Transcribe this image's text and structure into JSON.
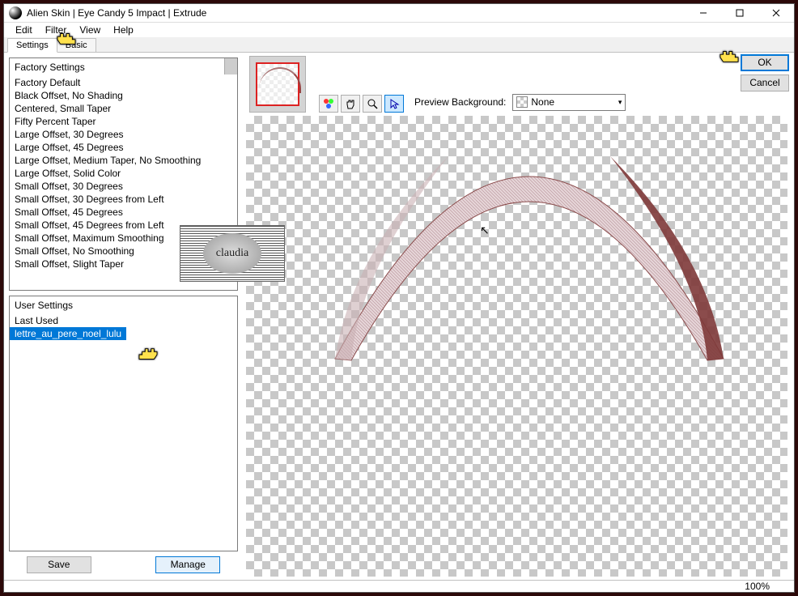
{
  "window_title": "Alien Skin | Eye Candy 5 Impact | Extrude",
  "menu": {
    "edit": "Edit",
    "filter": "Filter",
    "view": "View",
    "help": "Help"
  },
  "tabs": {
    "settings": "Settings",
    "basic": "Basic"
  },
  "factory": {
    "header": "Factory Settings",
    "items": [
      "Factory Default",
      "Black Offset, No Shading",
      "Centered, Small Taper",
      "Fifty Percent Taper",
      "Large Offset, 30 Degrees",
      "Large Offset, 45 Degrees",
      "Large Offset, Medium Taper, No Smoothing",
      "Large Offset, Solid Color",
      "Small Offset, 30 Degrees",
      "Small Offset, 30 Degrees from Left",
      "Small Offset, 45 Degrees",
      "Small Offset, 45 Degrees from Left",
      "Small Offset, Maximum Smoothing",
      "Small Offset, No Smoothing",
      "Small Offset, Slight Taper"
    ]
  },
  "user": {
    "header": "User Settings",
    "items": [
      "Last Used",
      "lettre_au_pere_noel_lulu"
    ],
    "selected_index": 1
  },
  "panel_buttons": {
    "save": "Save",
    "manage": "Manage"
  },
  "toolbar": {
    "preview_bg_label": "Preview Background:",
    "dropdown_value": "None"
  },
  "dialog_buttons": {
    "ok": "OK",
    "cancel": "Cancel"
  },
  "status": {
    "zoom": "100%"
  },
  "watermark_text": "claudia"
}
